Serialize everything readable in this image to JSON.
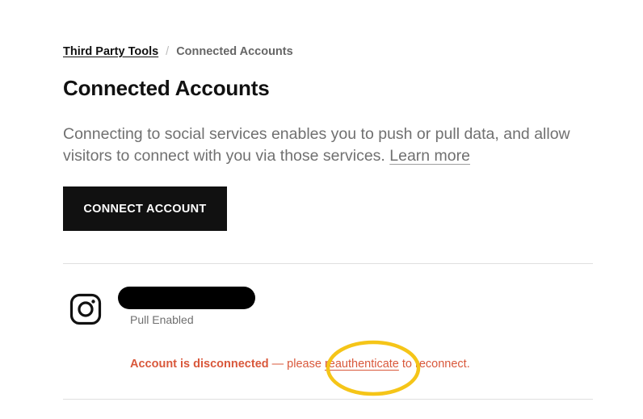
{
  "breadcrumb": {
    "parent": "Third Party Tools",
    "separator": "/",
    "current": "Connected Accounts"
  },
  "page": {
    "title": "Connected Accounts",
    "description": "Connecting to social services enables you to push or pull data, and allow visitors to connect with you via those services.",
    "learn_more": "Learn more",
    "connect_button": "CONNECT ACCOUNT"
  },
  "account": {
    "service_icon": "instagram-icon",
    "status": "Pull Enabled",
    "error_strong": "Account is disconnected",
    "error_prefix": " — please ",
    "error_link": "reauthenticate",
    "error_suffix": " to reconnect."
  },
  "colors": {
    "error": "#d9583b",
    "button_bg": "#111111",
    "highlight": "#f5c518"
  }
}
